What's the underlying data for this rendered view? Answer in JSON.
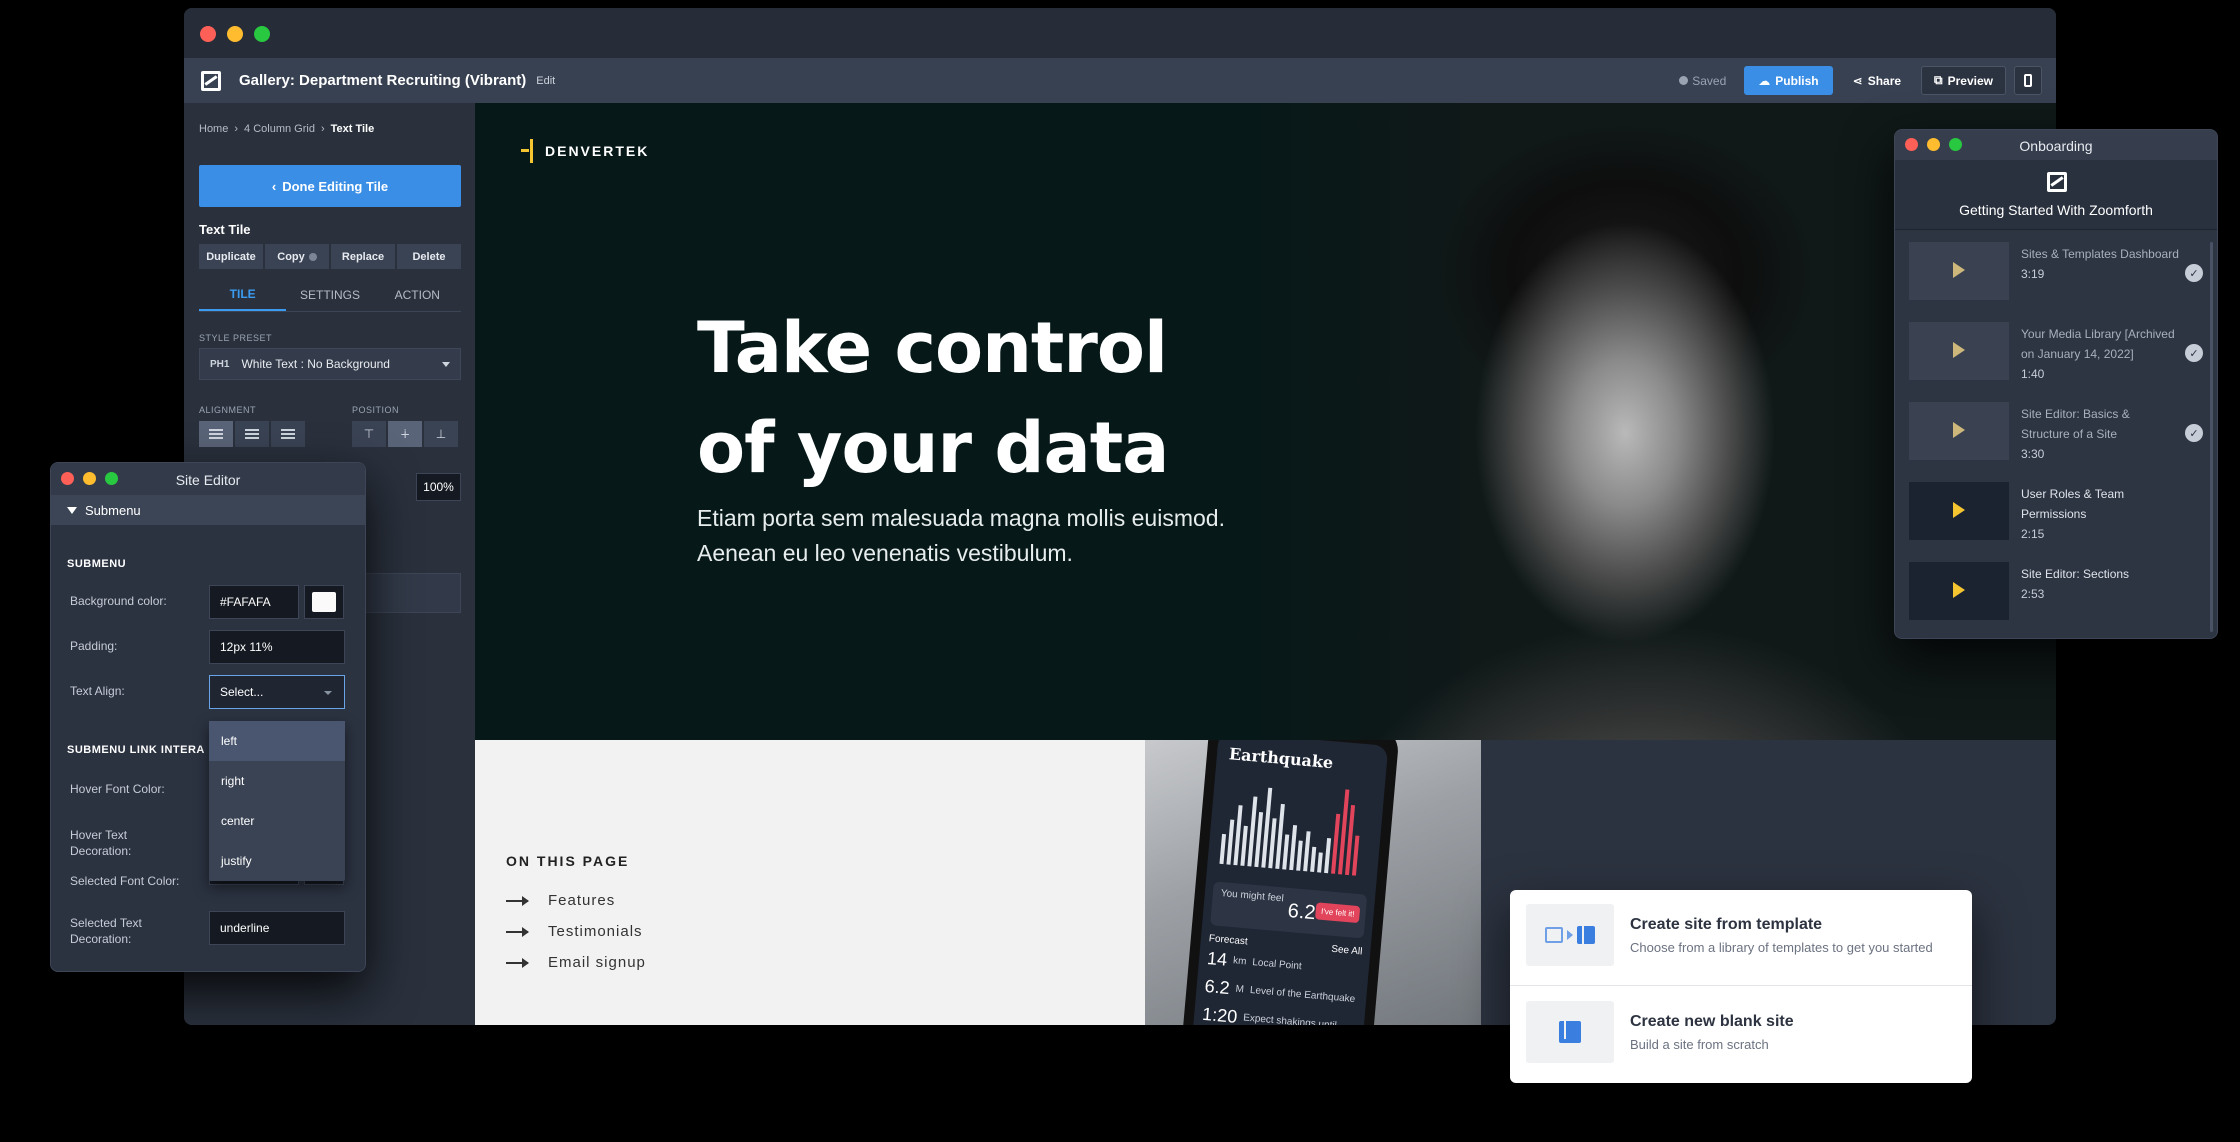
{
  "header": {
    "title": "Gallery: Department Recruiting (Vibrant)",
    "edit_label": "Edit",
    "saved_label": "Saved",
    "publish_label": "Publish",
    "share_label": "Share",
    "preview_label": "Preview"
  },
  "sidebar": {
    "breadcrumb": [
      "Home",
      "4 Column Grid",
      "Text Tile"
    ],
    "done_label": "Done Editing Tile",
    "tile_heading": "Text Tile",
    "actions": [
      "Duplicate",
      "Copy",
      "Replace",
      "Delete"
    ],
    "tabs": [
      "TILE",
      "SETTINGS",
      "ACTION"
    ],
    "style_preset_label": "STYLE PRESET",
    "style_preset_tag": "PH1",
    "style_preset_value": "White Text : No Background",
    "alignment_label": "ALIGNMENT",
    "position_label": "POSITION",
    "position_glyphs": [
      "⊤",
      "∔",
      "⊥"
    ],
    "percent_value": "100%"
  },
  "hero": {
    "brand": "DENVERTEK",
    "title": "Take control of your data",
    "subtitle": "Etiam porta sem malesuada magna mollis euismod. Aenean eu leo venenatis vestibulum."
  },
  "on_this_page": {
    "title": "ON THIS PAGE",
    "items": [
      "Features",
      "Testimonials",
      "Email signup"
    ]
  },
  "phone_app": {
    "title": "Earthquake",
    "card_label": "You might feel",
    "card_value": "6.2",
    "card_unit": "M",
    "felt_label": "I've felt it!",
    "forecast_label": "Forecast",
    "see_all": "See All",
    "forecast": [
      {
        "value": "14",
        "unit": "km",
        "label": "Local Point"
      },
      {
        "value": "6.2",
        "unit": "M",
        "label": "Level of the Earthquake"
      },
      {
        "value": "1:20",
        "unit": "",
        "label": "Expect shakings until"
      }
    ]
  },
  "onboarding": {
    "window_title": "Onboarding",
    "heading": "Getting Started With Zoomforth",
    "items": [
      {
        "name": "Sites & Templates Dashboard",
        "duration": "3:19",
        "done": true
      },
      {
        "name": "Your Media Library [Archived on January 14, 2022]",
        "duration": "1:40",
        "done": true
      },
      {
        "name": "Site Editor: Basics & Structure of a Site",
        "duration": "3:30",
        "done": true
      },
      {
        "name": "User Roles & Team Permissions",
        "duration": "2:15",
        "done": false
      },
      {
        "name": "Site Editor: Sections",
        "duration": "2:53",
        "done": false
      }
    ],
    "check_glyph": "✓"
  },
  "site_editor": {
    "window_title": "Site Editor",
    "accordion_label": "Submenu",
    "section1": "SUBMENU",
    "bg_label": "Background color:",
    "bg_value": "#FAFAFA",
    "padding_label": "Padding:",
    "padding_value": "12px 11%",
    "text_align_label": "Text Align:",
    "text_align_placeholder": "Select...",
    "section2": "SUBMENU LINK INTERA",
    "hover_font_label": "Hover Font Color:",
    "hover_deco_label": "Hover Text Decoration:",
    "selected_font_label": "Selected Font Color:",
    "selected_deco_label": "Selected Text Decoration:",
    "selected_deco_value": "underline",
    "align_options": [
      "left",
      "right",
      "center",
      "justify"
    ]
  },
  "create_options": [
    {
      "title": "Create site from template",
      "subtitle": "Choose from a library of templates to get you started"
    },
    {
      "title": "Create new blank site",
      "subtitle": "Build a site from scratch"
    }
  ],
  "colors": {
    "accent": "#3a8ee6",
    "brand_yellow": "#f4c431",
    "hero_bg": "#061818"
  }
}
